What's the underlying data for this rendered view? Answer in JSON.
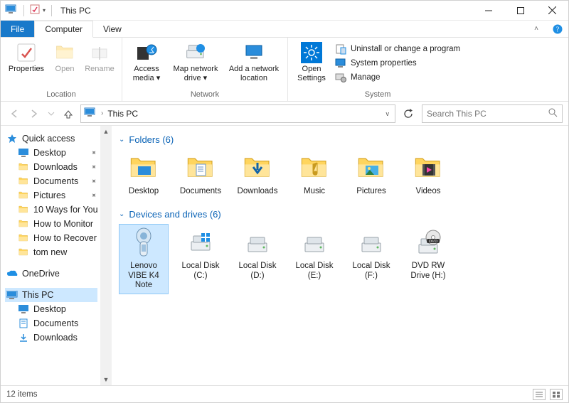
{
  "window": {
    "title": "This PC"
  },
  "tabs": {
    "file": "File",
    "computer": "Computer",
    "view": "View"
  },
  "ribbon": {
    "location": {
      "label": "Location",
      "properties": "Properties",
      "open": "Open",
      "rename": "Rename"
    },
    "network": {
      "label": "Network",
      "access_media": "Access media",
      "map_drive": "Map network drive",
      "add_location": "Add a network location"
    },
    "system": {
      "label": "System",
      "open_settings": "Open Settings",
      "uninstall": "Uninstall or change a program",
      "sysprops": "System properties",
      "manage": "Manage"
    }
  },
  "address": {
    "crumb": "This PC",
    "search_placeholder": "Search This PC"
  },
  "tree": {
    "quick_access": "Quick access",
    "desktop": "Desktop",
    "downloads": "Downloads",
    "documents": "Documents",
    "pictures": "Pictures",
    "item_10ways": "10 Ways for You",
    "item_howmonitor": "How to Monitor",
    "item_howrecover": "How to Recover",
    "item_tomnew": "tom new",
    "onedrive": "OneDrive",
    "thispc": "This PC",
    "thispc_desktop": "Desktop",
    "thispc_documents": "Documents",
    "thispc_downloads": "Downloads"
  },
  "sections": {
    "folders_header": "Folders (6)",
    "drives_header": "Devices and drives (6)"
  },
  "folders": {
    "desktop": "Desktop",
    "documents": "Documents",
    "downloads": "Downloads",
    "music": "Music",
    "pictures": "Pictures",
    "videos": "Videos"
  },
  "drives": {
    "device": "Lenovo VIBE K4 Note",
    "c": "Local Disk (C:)",
    "d": "Local Disk (D:)",
    "e": "Local Disk (E:)",
    "f": "Local Disk (F:)",
    "dvd": "DVD RW Drive (H:)"
  },
  "status": {
    "items": "12 items"
  }
}
